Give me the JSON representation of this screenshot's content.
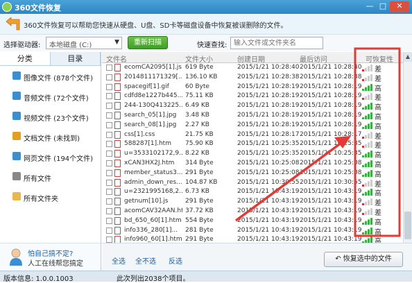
{
  "window": {
    "title": "360文件恢复",
    "controls": [
      "—",
      "□",
      "✕"
    ]
  },
  "banner": {
    "description": "360文件恢复可以帮助您快速从硬盘、U盘、SD卡等磁盘设备中恢复被误删除的文件。"
  },
  "toolbar": {
    "drive_label": "选择驱动器:",
    "drive_value": "本地磁盘 (C:)",
    "scan_button": "重新扫描",
    "search_label": "快速查找:",
    "search_placeholder": "输入文件或文件夹名"
  },
  "sidebar": {
    "tabs": [
      "分类",
      "目录"
    ],
    "categories": [
      {
        "label": "图像文件 (878个文件)",
        "icon": "image-file-icon",
        "color": "#3a8fd3"
      },
      {
        "label": "音频文件 (72个文件)",
        "icon": "audio-file-icon",
        "color": "#3a8fd3"
      },
      {
        "label": "视频文件 (23个文件)",
        "icon": "video-file-icon",
        "color": "#3a8fd3"
      },
      {
        "label": "文档文件 (未找到)",
        "icon": "document-file-icon",
        "color": "#e0a020"
      },
      {
        "label": "网页文件 (194个文件)",
        "icon": "webpage-file-icon",
        "color": "#3a8fd3"
      },
      {
        "label": "所有文件",
        "icon": "all-files-icon",
        "color": "#888888"
      },
      {
        "label": "所有文件夹",
        "icon": "folder-icon",
        "color": "#e8b84a"
      }
    ],
    "help": {
      "question": "怕自己搞不定?",
      "answer": "人工在线帮您搞定"
    }
  },
  "table": {
    "headers": [
      "文件名",
      "文件大小",
      "创建日期",
      "最后访问",
      "可恢复性"
    ],
    "rows": [
      {
        "name": "ecomCA2095[1].js",
        "size": "619 Byte",
        "created": "2015/1/21  10:28:40",
        "accessed": "2015/1/21  10:28:40",
        "level": "low",
        "recoverability": "差"
      },
      {
        "name": "2014811171329[...",
        "size": "136.10 KB",
        "created": "2015/1/21  10:28:38",
        "accessed": "2015/1/21  10:28:38",
        "level": "low",
        "recoverability": "差"
      },
      {
        "name": "spacegif[1].gif",
        "size": "60 Byte",
        "created": "2015/1/21  10:28:19",
        "accessed": "2015/1/21  10:28:19",
        "level": "high",
        "recoverability": "高"
      },
      {
        "name": "cdfd8e1227b445...",
        "size": "75.11 KB",
        "created": "2015/1/21  10:28:19",
        "accessed": "2015/1/21  10:28:19",
        "level": "low",
        "recoverability": "差"
      },
      {
        "name": "244-130Q413225...",
        "size": "6.49 KB",
        "created": "2015/1/21  10:28:19",
        "accessed": "2015/1/21  10:28:19",
        "level": "high",
        "recoverability": "高"
      },
      {
        "name": "search_05[1].jpg",
        "size": "3.48 KB",
        "created": "2015/1/21  10:28:19",
        "accessed": "2015/1/21  10:28:19",
        "level": "high",
        "recoverability": "高"
      },
      {
        "name": "search_08[1].jpg",
        "size": "2.27 KB",
        "created": "2015/1/21  10:28:19",
        "accessed": "2015/1/21  10:28:19",
        "level": "high",
        "recoverability": "高"
      },
      {
        "name": "css[1].css",
        "size": "21.75 KB",
        "created": "2015/1/21  10:28:17",
        "accessed": "2015/1/21  10:28:17",
        "level": "low",
        "recoverability": "差"
      },
      {
        "name": "588287[1].htm",
        "size": "75.90 KB",
        "created": "2015/1/21  10:25:35",
        "accessed": "2015/1/21  10:25:35",
        "level": "low",
        "recoverability": "差"
      },
      {
        "name": "u=3533102172,9...",
        "size": "8.22 KB",
        "created": "2015/1/21  10:25:35",
        "accessed": "2015/1/21  10:25:35",
        "level": "high",
        "recoverability": "高"
      },
      {
        "name": "xCAN3HX2J.htm",
        "size": "314 Byte",
        "created": "2015/1/21  10:25:08",
        "accessed": "2015/1/21  10:25:08",
        "level": "high",
        "recoverability": "高"
      },
      {
        "name": "member_status3...",
        "size": "291 Byte",
        "created": "2015/1/21  10:25:08",
        "accessed": "2015/1/21  10:25:08",
        "level": "high",
        "recoverability": "高"
      },
      {
        "name": "admin_down_res...",
        "size": "104.87 KB",
        "created": "2015/1/21  10:30:55",
        "accessed": "2015/1/21  10:30:55",
        "level": "low",
        "recoverability": "差"
      },
      {
        "name": "u=2321995168,2...",
        "size": "6.73 KB",
        "created": "2015/1/21  10:43:19",
        "accessed": "2015/1/21  10:43:19",
        "level": "high",
        "recoverability": "高"
      },
      {
        "name": "getnum[10].js",
        "size": "291 Byte",
        "created": "2015/1/21  10:43:19",
        "accessed": "2015/1/21  10:43:19",
        "level": "low",
        "recoverability": "差"
      },
      {
        "name": "acomCAV32AAN.htm",
        "size": "37.72 KB",
        "created": "2015/1/21  10:43:19",
        "accessed": "2015/1/21  10:43:19",
        "level": "low",
        "recoverability": "差"
      },
      {
        "name": "bd_650_60[1].htm",
        "size": "554 Byte",
        "created": "2015/1/21  10:43:19",
        "accessed": "2015/1/21  10:43:19",
        "level": "high",
        "recoverability": "高"
      },
      {
        "name": "info336_280[1]...",
        "size": "281 Byte",
        "created": "2015/1/21  10:43:19",
        "accessed": "2015/1/21  10:43:19",
        "level": "high",
        "recoverability": "高"
      },
      {
        "name": "info960_60[1].htm",
        "size": "291 Byte",
        "created": "2015/1/21  10:43:19",
        "accessed": "2015/1/21  10:43:19",
        "level": "high",
        "recoverability": "高"
      }
    ]
  },
  "bottom": {
    "select_all": "全选",
    "select_none": "全不选",
    "invert": "反选",
    "recover_button": "恢复选中的文件"
  },
  "status": {
    "version": "版本信息: 1.0.0.1003",
    "count": "此次列出2038个项目。"
  },
  "colors": {
    "accent": "#2e86c4",
    "scan_green": "#4caf2a",
    "signal_high": "#3cb043",
    "signal_low": "#d03030",
    "annotation_red": "#e53935"
  }
}
